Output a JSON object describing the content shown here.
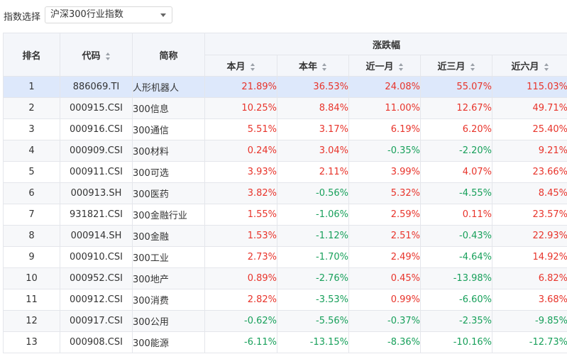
{
  "toolbar": {
    "label": "指数选择",
    "select_value": "沪深300行业指数"
  },
  "table": {
    "headers": {
      "rank": "排名",
      "code": "代码",
      "name": "简称",
      "group": "涨跌幅",
      "month": "本月",
      "year": "本年",
      "m1": "近一月",
      "m3": "近三月",
      "m6": "近六月"
    },
    "rows": [
      {
        "rank": "1",
        "code": "886069.TI",
        "name": "人形机器人",
        "month": "21.89%",
        "year": "36.53%",
        "m1": "24.08%",
        "m3": "55.07%",
        "m6": "115.03%"
      },
      {
        "rank": "2",
        "code": "000915.CSI",
        "name": "300信息",
        "month": "10.25%",
        "year": "8.84%",
        "m1": "11.00%",
        "m3": "12.67%",
        "m6": "49.71%"
      },
      {
        "rank": "3",
        "code": "000916.CSI",
        "name": "300通信",
        "month": "5.51%",
        "year": "3.17%",
        "m1": "6.19%",
        "m3": "6.20%",
        "m6": "25.40%"
      },
      {
        "rank": "4",
        "code": "000909.CSI",
        "name": "300材料",
        "month": "0.24%",
        "year": "3.04%",
        "m1": "-0.35%",
        "m3": "-2.20%",
        "m6": "9.21%"
      },
      {
        "rank": "5",
        "code": "000911.CSI",
        "name": "300可选",
        "month": "3.93%",
        "year": "2.11%",
        "m1": "3.99%",
        "m3": "4.07%",
        "m6": "23.66%"
      },
      {
        "rank": "6",
        "code": "000913.SH",
        "name": "300医药",
        "month": "3.82%",
        "year": "-0.56%",
        "m1": "5.32%",
        "m3": "-4.55%",
        "m6": "8.45%"
      },
      {
        "rank": "7",
        "code": "931821.CSI",
        "name": "300金融行业",
        "month": "1.55%",
        "year": "-1.06%",
        "m1": "2.59%",
        "m3": "0.11%",
        "m6": "23.57%"
      },
      {
        "rank": "8",
        "code": "000914.SH",
        "name": "300金融",
        "month": "1.53%",
        "year": "-1.12%",
        "m1": "2.51%",
        "m3": "-0.43%",
        "m6": "22.93%"
      },
      {
        "rank": "9",
        "code": "000910.CSI",
        "name": "300工业",
        "month": "2.73%",
        "year": "-1.70%",
        "m1": "2.49%",
        "m3": "-4.64%",
        "m6": "14.92%"
      },
      {
        "rank": "10",
        "code": "000952.CSI",
        "name": "300地产",
        "month": "0.89%",
        "year": "-2.76%",
        "m1": "0.45%",
        "m3": "-13.98%",
        "m6": "6.82%"
      },
      {
        "rank": "11",
        "code": "000912.CSI",
        "name": "300消费",
        "month": "2.82%",
        "year": "-3.53%",
        "m1": "0.99%",
        "m3": "-6.60%",
        "m6": "3.68%"
      },
      {
        "rank": "12",
        "code": "000917.CSI",
        "name": "300公用",
        "month": "-0.62%",
        "year": "-5.56%",
        "m1": "-0.37%",
        "m3": "-2.35%",
        "m6": "-9.85%"
      },
      {
        "rank": "13",
        "code": "000908.CSI",
        "name": "300能源",
        "month": "-6.11%",
        "year": "-13.15%",
        "m1": "-8.36%",
        "m3": "-10.16%",
        "m6": "-12.73%"
      }
    ]
  },
  "colors": {
    "positive": "#e8342b",
    "negative": "#18a05b",
    "selected_row": "#dde8fb",
    "header_bg": "#f4f6fa"
  },
  "icons": {
    "dropdown": "chevron-down-icon",
    "sort": "sort-icon"
  }
}
